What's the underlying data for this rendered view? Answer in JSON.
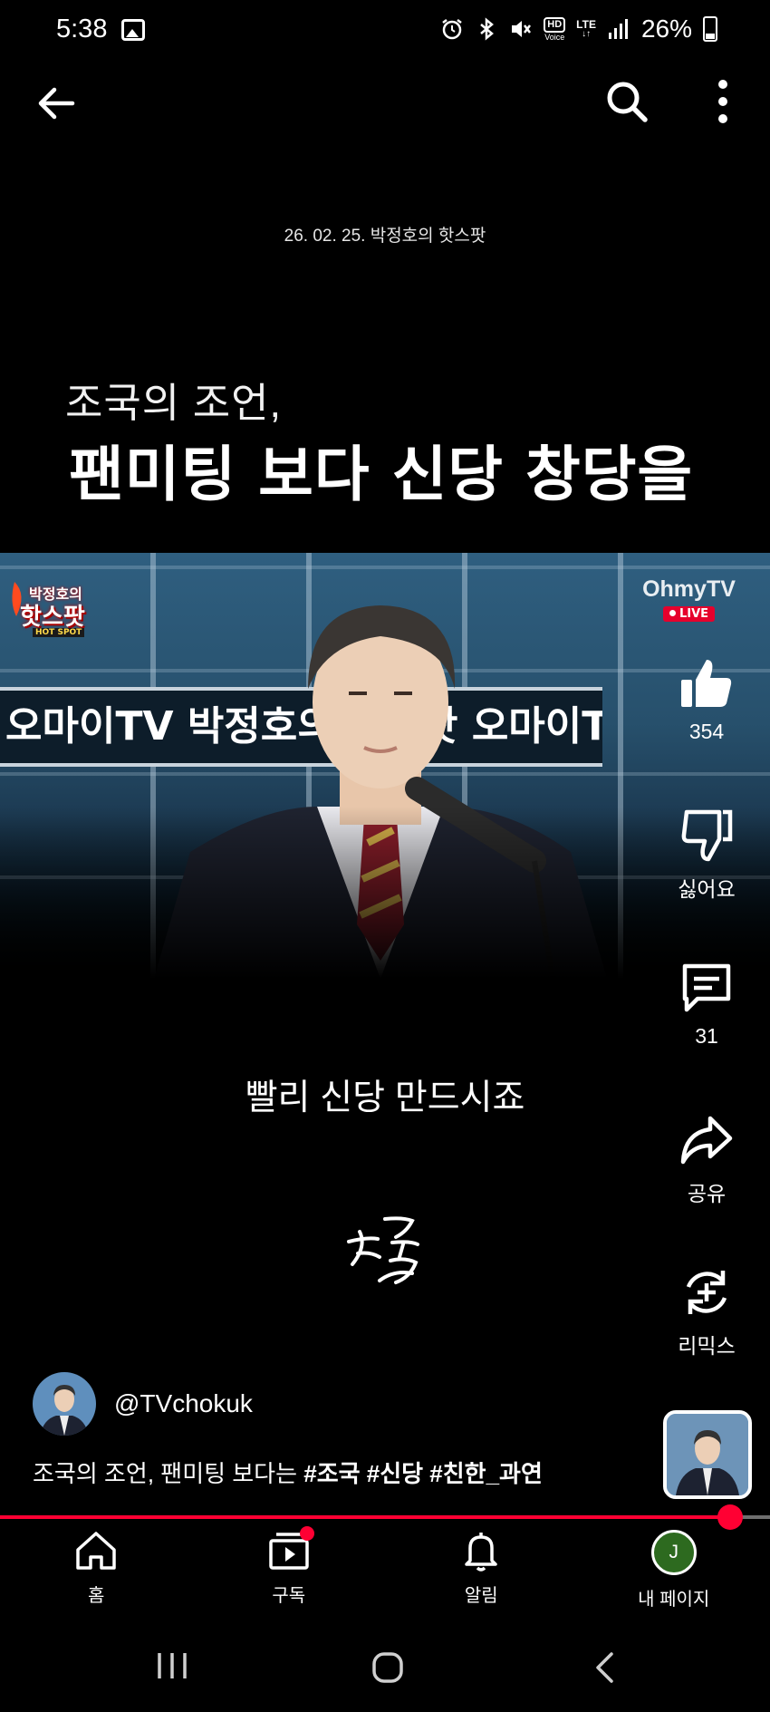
{
  "status_bar": {
    "time": "5:38",
    "hd_label": "HD",
    "hd_sub": "Voice",
    "network": "LTE",
    "battery_percent": "26%",
    "icons": [
      "gallery-icon",
      "alarm-icon",
      "bluetooth-icon",
      "mute-icon",
      "hd-voice-icon",
      "lte-icon",
      "signal-icon",
      "battery-icon"
    ]
  },
  "top_bar": {
    "icons": [
      "back-arrow-icon",
      "search-icon",
      "more-vert-icon"
    ]
  },
  "video": {
    "date_line": "26. 02. 25. 박정호의 핫스팟",
    "headline_small": "조국의 조언,",
    "headline_big": "팬미팅 보다 신당 창당을",
    "ticker_text": "오마이TV 박정호의 핫스팟 오마이TV 박정호의 핫스팟",
    "program_logo_line1": "박정호의",
    "program_logo_line2": "핫스팟",
    "program_logo_line3": "HOT SPOT",
    "broadcaster": "OhmyTV",
    "live_badge": "LIVE",
    "caption": "빨리 신당 만드시죠",
    "signature_text": "조국"
  },
  "actions": {
    "like_count": "354",
    "dislike_label": "싫어요",
    "comment_count": "31",
    "share_label": "공유",
    "remix_label": "리믹스"
  },
  "channel": {
    "handle": "@TVchokuk"
  },
  "title": {
    "text": "조국의 조언, 팬미팅 보다는 ",
    "hashtags": "#조국 #신당 #친한_과연"
  },
  "progress": {
    "fraction": 0.948
  },
  "bottom_nav": {
    "home_label": "홈",
    "subs_label": "구독",
    "notif_label": "알림",
    "me_label": "내 페이지",
    "avatar_letter": "J"
  },
  "colors": {
    "accent": "#ff0033",
    "background": "#000000",
    "studio_blue": "#2f5f80",
    "avatar_green": "#2d6a1f"
  }
}
